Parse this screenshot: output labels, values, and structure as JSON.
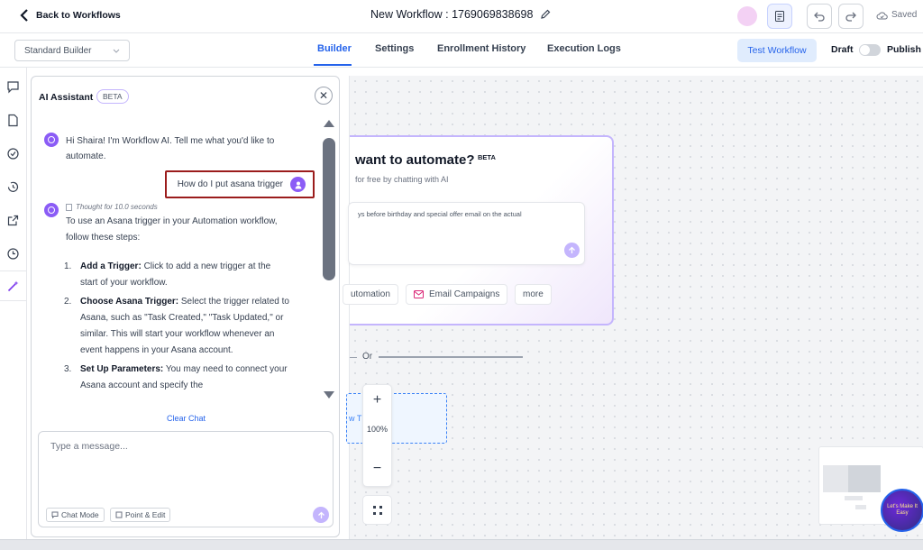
{
  "header": {
    "back_label": "Back to Workflows",
    "workflow_title": "New Workflow : 1769069838698",
    "saved_label": "Saved"
  },
  "subheader": {
    "builder_select": "Standard Builder",
    "tabs": [
      {
        "label": "Builder",
        "active": true
      },
      {
        "label": "Settings"
      },
      {
        "label": "Enrollment History"
      },
      {
        "label": "Execution Logs"
      }
    ],
    "test_workflow_label": "Test Workflow",
    "draft_label": "Draft",
    "publish_label": "Publish"
  },
  "rail_icons": [
    "chat-icon",
    "file-icon",
    "check-circle-icon",
    "history-icon",
    "external-link-icon",
    "clock-icon",
    "magic-wand-icon"
  ],
  "assistant": {
    "title": "AI Assistant",
    "badge": "BETA",
    "greeting": "Hi Shaira! I'm Workflow AI. Tell me what you'd like to automate.",
    "user_message": "How do I put asana trigger",
    "thought": "Thought for 10.0 seconds",
    "response_intro": "To use an Asana trigger in your Automation workflow, follow these steps:",
    "steps": [
      {
        "num": "1.",
        "title": "Add a Trigger:",
        "text": " Click to add a new trigger at the start of your workflow."
      },
      {
        "num": "2.",
        "title": "Choose Asana Trigger:",
        "text": " Select the trigger related to Asana, such as \"Task Created,\" \"Task Updated,\" or similar. This will start your workflow whenever an event happens in your Asana account."
      },
      {
        "num": "3.",
        "title": "Set Up Parameters:",
        "text": " You may need to connect your Asana account and specify the"
      }
    ],
    "clear_chat": "Clear Chat",
    "input_placeholder": "Type a message...",
    "chat_mode_label": "Chat Mode",
    "point_edit_label": "Point & Edit"
  },
  "canvas": {
    "card_title": "want to automate?",
    "card_badge": "BETA",
    "card_subtitle": "for free by chatting with AI",
    "card_input_text": "ys before birthday and special offer email on the actual",
    "chips": [
      "utomation",
      "Email Campaigns",
      "more"
    ],
    "or_label": "Or",
    "dashed_text": "w T",
    "zoom_level": "100%",
    "assistant_bubble_text": "Let's Make It Easy"
  },
  "colors": {
    "accent": "#2563eb",
    "ai_purple": "#8b5cf6",
    "highlight_border": "#9b1c1c"
  }
}
